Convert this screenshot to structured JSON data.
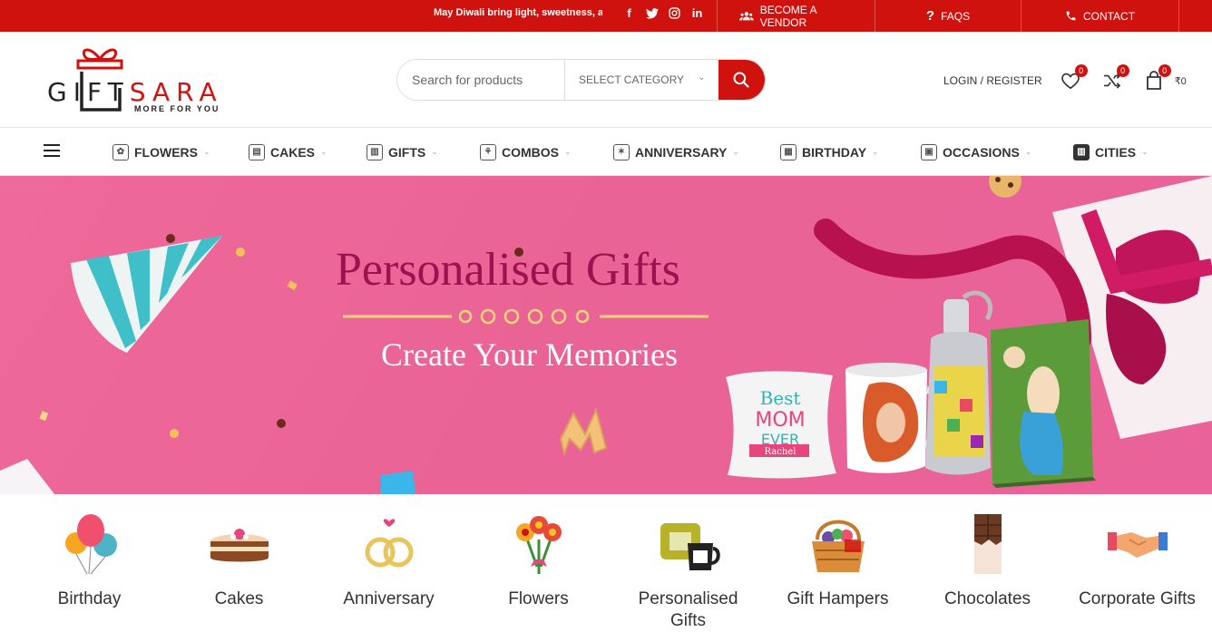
{
  "topbar": {
    "marquee": "May Diwali bring light, sweetness, and joy",
    "social": [
      "facebook-icon",
      "twitter-icon",
      "instagram-icon",
      "linkedin-icon"
    ],
    "links": {
      "vendor": "BECOME A VENDOR",
      "faqs": "FAQS",
      "contact": "CONTACT"
    }
  },
  "header": {
    "logo": {
      "left": "G",
      "mid": "IFT",
      "right": "SARA",
      "tagline": "MORE FOR YOU"
    },
    "search": {
      "placeholder": "Search for products",
      "category": "SELECT CATEGORY"
    },
    "login": "LOGIN / REGISTER",
    "wishlist_count": "0",
    "compare_count": "0",
    "cart_count": "0",
    "cart_amount": "₹0"
  },
  "nav": {
    "items": [
      {
        "label": "FLOWERS",
        "icon": "flower-icon"
      },
      {
        "label": "CAKES",
        "icon": "cake-icon"
      },
      {
        "label": "GIFTS",
        "icon": "gift-icon"
      },
      {
        "label": "COMBOS",
        "icon": "combo-icon"
      },
      {
        "label": "ANNIVERSARY",
        "icon": "anniversary-icon"
      },
      {
        "label": "BIRTHDAY",
        "icon": "birthday-cake-icon"
      },
      {
        "label": "OCCASIONS",
        "icon": "box-icon"
      },
      {
        "label": "CITIES",
        "icon": "city-icon"
      }
    ]
  },
  "banner": {
    "title": "Personalised Gifts",
    "subtitle": "Create Your Memories",
    "pillow_text": [
      "Best",
      "MOM",
      "EVER",
      "Rachel"
    ]
  },
  "categories": [
    {
      "label": "Birthday",
      "icon": "balloons-icon"
    },
    {
      "label": "Cakes",
      "icon": "cake-icon"
    },
    {
      "label": "Anniversary",
      "icon": "rings-icon"
    },
    {
      "label": "Flowers",
      "icon": "bouquet-icon"
    },
    {
      "label": "Personalised Gifts",
      "icon": "personalised-gift-icon"
    },
    {
      "label": "Gift Hampers",
      "icon": "hamper-icon"
    },
    {
      "label": "Chocolates",
      "icon": "chocolate-icon"
    },
    {
      "label": "Corporate Gifts",
      "icon": "handshake-icon"
    }
  ],
  "colors": {
    "brand": "#d0120f",
    "banner_bg": "#ea6395",
    "banner_title": "#9d1150"
  }
}
